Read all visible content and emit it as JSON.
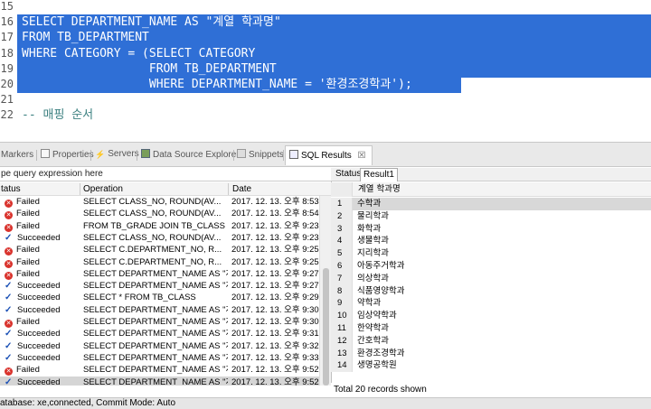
{
  "editor": {
    "lines": [
      {
        "num": "15",
        "code": "",
        "selected": false
      },
      {
        "num": "16",
        "code": "SELECT DEPARTMENT_NAME AS \"계열 학과명\"",
        "selected": true
      },
      {
        "num": "17",
        "code": "FROM TB_DEPARTMENT",
        "selected": true
      },
      {
        "num": "18",
        "code": "WHERE CATEGORY = (SELECT CATEGORY",
        "selected": true
      },
      {
        "num": "19",
        "code": "                  FROM TB_DEPARTMENT",
        "selected": true
      },
      {
        "num": "20",
        "code": "                  WHERE DEPARTMENT_NAME = '환경조경학과');",
        "selected": true
      },
      {
        "num": "21",
        "code": "",
        "selected": false
      },
      {
        "num": "22",
        "code": "-- 매핑 순서",
        "selected": false
      }
    ]
  },
  "view_tabs": [
    {
      "label": "Markers",
      "icon": "markers-icon"
    },
    {
      "label": "Properties",
      "icon": "properties-icon"
    },
    {
      "label": "Servers",
      "icon": "servers-icon"
    },
    {
      "label": "Data Source Explorer",
      "icon": "data-source-explorer-icon"
    },
    {
      "label": "Snippets",
      "icon": "snippets-icon"
    },
    {
      "label": "SQL Results",
      "icon": "sql-results-icon",
      "active": true,
      "close": "☒"
    }
  ],
  "history": {
    "filter_text": "pe query expression here",
    "columns": {
      "status": "tatus",
      "operation": "Operation",
      "date": "Date"
    },
    "rows": [
      {
        "status": "Failed",
        "operation": "SELECT CLASS_NO,          ROUND(AV...",
        "date": "2017. 12. 13. 오후 8:53:"
      },
      {
        "status": "Failed",
        "operation": "SELECT CLASS_NO,          ROUND(AV...",
        "date": "2017. 12. 13. 오후 8:54:"
      },
      {
        "status": "Failed",
        "operation": "FROM TB_GRADE  JOIN TB_CLASS USI...",
        "date": "2017. 12. 13. 오후 9:23:"
      },
      {
        "status": "Succeeded",
        "operation": "SELECT CLASS_NO,          ROUND(AV...",
        "date": "2017. 12. 13. 오후 9:23:"
      },
      {
        "status": "Failed",
        "operation": "SELECT C.DEPARTMENT_NO,          R...",
        "date": "2017. 12. 13. 오후 9:25:"
      },
      {
        "status": "Failed",
        "operation": "SELECT C.DEPARTMENT_NO,          R...",
        "date": "2017. 12. 13. 오후 9:25:"
      },
      {
        "status": "Failed",
        "operation": "SELECT DEPARTMENT_NAME AS \"계...",
        "date": "2017. 12. 13. 오후 9:27:"
      },
      {
        "status": "Succeeded",
        "operation": "SELECT DEPARTMENT_NAME AS \"계...",
        "date": "2017. 12. 13. 오후 9:27:"
      },
      {
        "status": "Succeeded",
        "operation": "SELECT *  FROM TB_CLASS",
        "date": "2017. 12. 13. 오후 9:29:"
      },
      {
        "status": "Succeeded",
        "operation": "SELECT DEPARTMENT_NAME AS \"계...",
        "date": "2017. 12. 13. 오후 9:30:"
      },
      {
        "status": "Failed",
        "operation": "SELECT DEPARTMENT_NAME AS \"계...",
        "date": "2017. 12. 13. 오후 9:30:"
      },
      {
        "status": "Succeeded",
        "operation": "SELECT DEPARTMENT_NAME AS \"계...",
        "date": "2017. 12. 13. 오후 9:31:"
      },
      {
        "status": "Succeeded",
        "operation": "SELECT DEPARTMENT_NAME AS \"계...",
        "date": "2017. 12. 13. 오후 9:32:"
      },
      {
        "status": "Succeeded",
        "operation": "SELECT DEPARTMENT_NAME AS \"계...",
        "date": "2017. 12. 13. 오후 9:33:"
      },
      {
        "status": "Failed",
        "operation": "SELECT DEPARTMENT_NAME AS \"계...",
        "date": "2017. 12. 13. 오후 9:52:"
      },
      {
        "status": "Succeeded",
        "operation": "SELECT DEPARTMENT_NAME AS \"계...",
        "date": "2017. 12. 13. 오후 9:52:"
      }
    ]
  },
  "results": {
    "tabs": [
      {
        "label": "Status"
      },
      {
        "label": "Result1",
        "active": true
      }
    ],
    "column_header": "계열 학과명",
    "rows": [
      {
        "n": "1",
        "v": "수학과"
      },
      {
        "n": "2",
        "v": "물리학과"
      },
      {
        "n": "3",
        "v": "화학과"
      },
      {
        "n": "4",
        "v": "생물학과"
      },
      {
        "n": "5",
        "v": "지리학과"
      },
      {
        "n": "6",
        "v": "아동주거학과"
      },
      {
        "n": "7",
        "v": "의상학과"
      },
      {
        "n": "8",
        "v": "식품영양학과"
      },
      {
        "n": "9",
        "v": "약학과"
      },
      {
        "n": "10",
        "v": "임상약학과"
      },
      {
        "n": "11",
        "v": "한약학과"
      },
      {
        "n": "12",
        "v": "간호학과"
      },
      {
        "n": "13",
        "v": "환경조경학과"
      },
      {
        "n": "14",
        "v": "생명공학원"
      }
    ],
    "footer": "Total 20 records shown"
  },
  "statusbar": {
    "text": "atabase: xe,connected, Commit Mode: Auto"
  },
  "colors": {
    "selection": "#2f6fd6",
    "failed": "#d9322c",
    "succeeded": "#1a4fb5"
  }
}
